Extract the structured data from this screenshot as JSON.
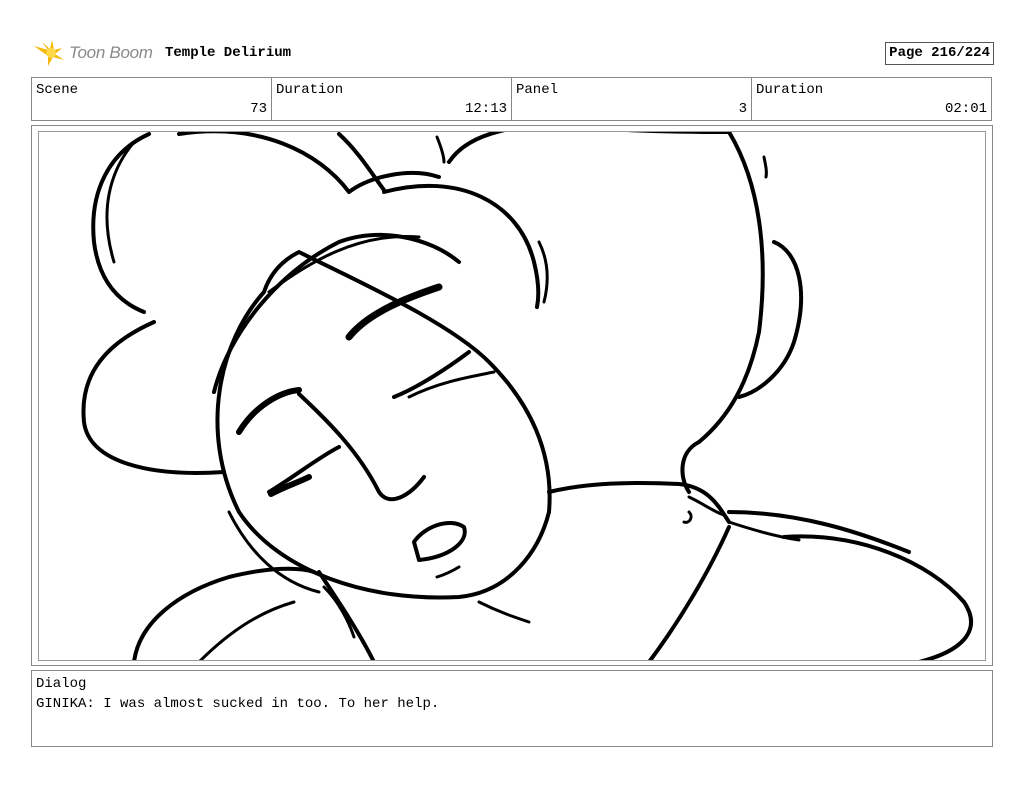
{
  "header": {
    "brand": "Toon Boom",
    "project": "Temple Delirium",
    "page": "Page 216/224"
  },
  "meta": {
    "scene_label": "Scene",
    "scene_value": "73",
    "duration_label": "Duration",
    "duration_value": "12:13",
    "panel_label": "Panel",
    "panel_value": "3",
    "panel_duration_label": "Duration",
    "panel_duration_value": "02:01"
  },
  "dialog": {
    "label": "Dialog",
    "text": "GINIKA: I was almost sucked in too. To her help."
  },
  "colors": {
    "logo_star": "#f5b800",
    "brand_text": "#8a8a8a",
    "border": "#888888"
  }
}
